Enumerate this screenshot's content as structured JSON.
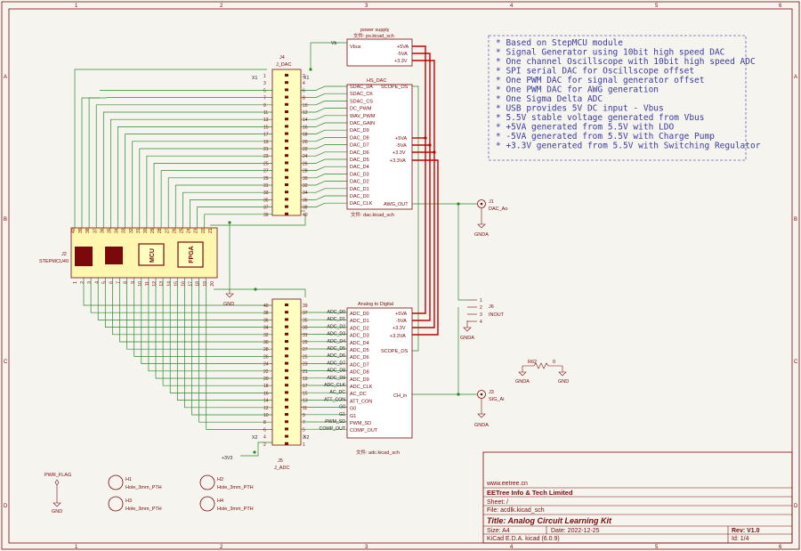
{
  "frame": {
    "cols": [
      "1",
      "2",
      "3",
      "4",
      "5",
      "6"
    ],
    "rows": [
      "A",
      "B",
      "C",
      "D"
    ]
  },
  "notes": [
    "* Based on StepMCU module",
    "* Signal Generator using 10bit high speed DAC",
    "* One channel Oscillscope with 10bit high speed ADC",
    "* SPI serial DAC for Oscillscope offset",
    "* One PWM DAC for signal generator offset",
    "* One PWM DAC for AWG generation",
    "* One Sigma Delta ADC",
    "* USB provides 5V DC input - Vbus",
    "* 5.5V stable voltage generated from Vbus",
    "* +5VA generated from 5.5V with LDO",
    "* -5VA generated from 5.5V with Charge Pump",
    "* +3.3V generated from 5.5V with Switching Regulator"
  ],
  "power_sheet": {
    "title": "power supply",
    "file": "文件: ps.kicad_sch",
    "in_pin": "Vbus",
    "out_pins": [
      "+5VA",
      "-5VA",
      "+3.3V"
    ],
    "vb_label": "Vb"
  },
  "dac_sheet": {
    "title": "HS_DAC",
    "file": "文件: dac.kicad_sch",
    "left_pins": [
      "SDAC_DA",
      "SDAC_CK",
      "SDAC_CS",
      "DC_PWM",
      "WAV_PWM",
      "DAC_GAIN",
      "DAC_D9",
      "DAC_D8",
      "DAC_D7",
      "DAC_D6",
      "DAC_D5",
      "DAC_D4",
      "DAC_D3",
      "DAC_D2",
      "DAC_D1",
      "DAC_D0",
      "DAC_CLK"
    ],
    "right_pins": [
      "SCOPE_OS",
      "+5VA",
      "-5VA",
      "+3.3V",
      "+3.3VA",
      "AWG_OUT"
    ]
  },
  "adc_sheet": {
    "title": "Analog to Digital",
    "file": "文件: adc.kicad_sch",
    "left_pins": [
      "ADC_D0",
      "ADC_D1",
      "ADC_D2",
      "ADC_D3",
      "ADC_D4",
      "ADC_D5",
      "ADC_D6",
      "ADC_D7",
      "ADC_D8",
      "ADC_D9",
      "ADC_CLK",
      "AC_DC",
      "ATT_CON",
      "G0",
      "G1",
      "PWM_SD",
      "COMP_OUT"
    ],
    "right_pins": [
      "+5VA",
      "-5VA",
      "+3.3V",
      "+3.3VA",
      "SCOPE_OS",
      "CH_in"
    ],
    "wire_labels": [
      "ADC_D0",
      "ADC_D1",
      "ADC_D2",
      "ADC_D3",
      "ADC_D4",
      "ADC_D5",
      "ADC_D6",
      "ADC_D7",
      "ADC_D8",
      "ADC_D9",
      "ADC_CLK",
      "AC_DC",
      "ATT_CON",
      "G0",
      "G1",
      "PWM_SD",
      "COMP_OUT"
    ]
  },
  "j4": {
    "ref": "J4",
    "value": "J_DAC",
    "left_nums": [
      "1",
      "3",
      "5",
      "7",
      "9",
      "11",
      "13",
      "15",
      "17",
      "19",
      "21",
      "23",
      "25",
      "27",
      "29",
      "31",
      "33",
      "35",
      "37",
      "39"
    ],
    "right_nums": [
      "2",
      "4",
      "6",
      "8",
      "10",
      "12",
      "14",
      "16",
      "18",
      "20",
      "22",
      "24",
      "26",
      "28",
      "30",
      "32",
      "34",
      "36",
      "38",
      "40"
    ],
    "x1_left": "X1",
    "x1_right": "X1"
  },
  "j5": {
    "ref": "J5",
    "value": "J_ADC",
    "left_nums": [
      "40",
      "38",
      "36",
      "34",
      "32",
      "30",
      "28",
      "26",
      "24",
      "22",
      "20",
      "18",
      "16",
      "14",
      "12",
      "10",
      "8",
      "6",
      "4",
      "2"
    ],
    "right_nums": [
      "39",
      "37",
      "35",
      "33",
      "31",
      "29",
      "27",
      "25",
      "23",
      "21",
      "19",
      "17",
      "15",
      "13",
      "11",
      "9",
      "7",
      "5",
      "3",
      "1"
    ],
    "x2_left": "X2",
    "x2_right": "X2",
    "v33": "+3V3"
  },
  "j2": {
    "ref": "J2",
    "value": "STEPMCU40",
    "top_nums": [
      "40",
      "39",
      "38",
      "37",
      "36",
      "35",
      "34",
      "33",
      "32",
      "31",
      "30",
      "29",
      "28",
      "27",
      "26",
      "25",
      "24",
      "23",
      "22",
      "21"
    ],
    "bottom_nums": [
      "1",
      "2",
      "3",
      "4",
      "5",
      "6",
      "7",
      "8",
      "9",
      "10",
      "11",
      "12",
      "13",
      "14",
      "15",
      "16",
      "17",
      "18",
      "19",
      "20"
    ],
    "chip_mcu": "MCU",
    "chip_fpga": "FPGA"
  },
  "connectors": {
    "j1": {
      "ref": "J1",
      "value": "DAC_Ao",
      "gnd": "GNDA"
    },
    "j3": {
      "ref": "J3",
      "value": "SIG_Ai",
      "gnd": "GNDA"
    },
    "j6": {
      "ref": "J6",
      "value": "INOUT",
      "pins": [
        "1",
        "2",
        "3",
        "4"
      ],
      "gnd": "GNDA"
    }
  },
  "r62": {
    "ref": "R62",
    "value": "0",
    "left": "GNDA",
    "right": "GND"
  },
  "gnd_label": "GND",
  "pwr_flag": {
    "label": "PWR_FLAG",
    "gnd": "GND"
  },
  "holes": [
    {
      "ref": "H1",
      "value": "Hole_3mm_PTH"
    },
    {
      "ref": "H2",
      "value": "Hole_3mm_PTH"
    },
    {
      "ref": "H3",
      "value": "Hole_3mm_PTH"
    },
    {
      "ref": "H4",
      "value": "Hole_3mm_PTH"
    }
  ],
  "title_block": {
    "url": "www.eetree.cn",
    "company": "EETree Info & Tech Limited",
    "sheet": "Sheet: /",
    "file": "File: acdlk.kicad_sch",
    "title": "Title: Analog Circuit Learning Kit",
    "size": "Size: A4",
    "date": "Date: 2022-12-25",
    "rev": "Rev: V1.0",
    "tool": "KiCad E.D.A.  kicad (6.0.9)",
    "id": "Id: 1/4"
  },
  "colors": {
    "wire": "#2a8a2a",
    "bus_power": "#c00000",
    "border": "#7a0a0a",
    "sheet_border": "#7a0a0a",
    "note_text": "#3a3aa0",
    "note_border": "#6666bb",
    "connector_body": "#ffffc0",
    "stepmcu_body": "#fff7b0",
    "chip_dark": "#7a0a0a",
    "junction": "#2a8a2a"
  }
}
